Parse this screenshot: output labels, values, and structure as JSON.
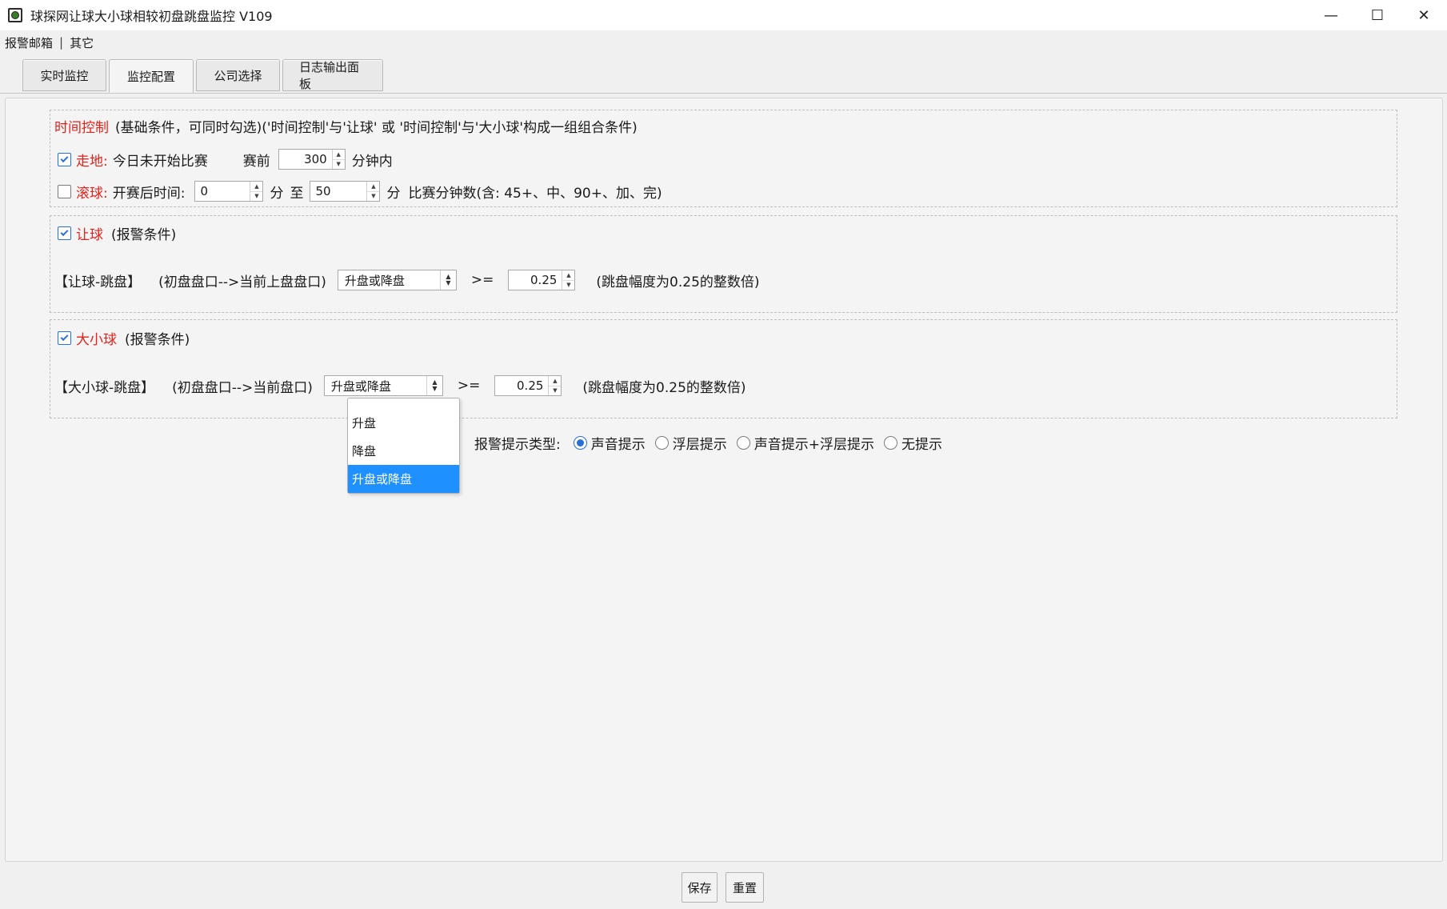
{
  "window": {
    "title": "球探网让球大小球相较初盘跳盘监控 V109",
    "minimize": "—",
    "maximize": "☐",
    "close": "✕"
  },
  "menu": {
    "items": [
      "报警邮箱",
      "其它"
    ],
    "separator": "|"
  },
  "tabs": [
    {
      "label": "实时监控"
    },
    {
      "label": "监控配置",
      "active": true
    },
    {
      "label": "公司选择"
    },
    {
      "label": "日志输出面板"
    }
  ],
  "time_control": {
    "title": "时间控制",
    "description": "(基础条件，可同时勾选)('时间控制'与'让球' 或 '时间控制'与'大小球'构成一组组合条件)",
    "walk": {
      "checked": true,
      "label": "走地:",
      "text": "今日未开始比赛",
      "before_label": "赛前",
      "minutes_value": "300",
      "unit": "分钟内"
    },
    "live": {
      "checked": false,
      "label": "滚球:",
      "text": "开赛后时间:",
      "from_value": "0",
      "from_unit": "分",
      "to_label": "至",
      "to_value": "50",
      "to_unit": "分",
      "note": "比赛分钟数(含: 45+、中、90+、加、完)"
    }
  },
  "handicap": {
    "checked": true,
    "title": "让球",
    "subtitle": "(报警条件)",
    "row_label": "【让球-跳盘】",
    "desc": "(初盘盘口-->当前上盘盘口)",
    "combo_value": "升盘或降盘",
    "operator": ">=",
    "threshold": "0.25",
    "note": "(跳盘幅度为0.25的整数倍)"
  },
  "overunder": {
    "checked": true,
    "title": "大小球",
    "subtitle": "(报警条件)",
    "row_label": "【大小球-跳盘】",
    "desc": "(初盘盘口-->当前盘口)",
    "combo_value": "升盘或降盘",
    "operator": ">=",
    "threshold": "0.25",
    "note": "(跳盘幅度为0.25的整数倍)"
  },
  "dropdown": {
    "options": [
      "升盘",
      "降盘",
      "升盘或降盘"
    ],
    "selected_index": 2
  },
  "alert_type": {
    "label": "报警提示类型:",
    "options": [
      "声音提示",
      "浮层提示",
      "声音提示+浮层提示",
      "无提示"
    ],
    "selected_index": 0
  },
  "buttons": {
    "save": "保存",
    "reset": "重置"
  },
  "colors": {
    "accent": "#2a6fd6",
    "highlight": "#1e90ff",
    "label_red": "#e2241c"
  }
}
